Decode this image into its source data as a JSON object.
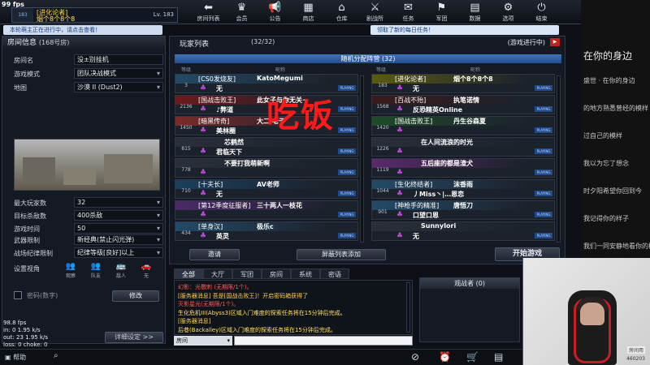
{
  "fps_top": "99 fps",
  "player": {
    "rank_text": "183",
    "clan_tag": "[进化论者]",
    "name": "烟个8个8个8",
    "level": "Lv. 183"
  },
  "nav": [
    {
      "label": "房间列表",
      "icon": "back-arrow-icon",
      "glyph": "⬅"
    },
    {
      "label": "会员",
      "icon": "crown-icon",
      "glyph": "♛"
    },
    {
      "label": "公告",
      "icon": "megaphone-icon",
      "glyph": "📢"
    },
    {
      "label": "商店",
      "icon": "shop-icon",
      "glyph": "▦"
    },
    {
      "label": "仓库",
      "icon": "warehouse-icon",
      "glyph": "⌂"
    },
    {
      "label": "剧战所",
      "icon": "battle-icon",
      "glyph": "⚔"
    },
    {
      "label": "任务",
      "icon": "mission-icon",
      "glyph": "✉"
    },
    {
      "label": "军团",
      "icon": "legion-icon",
      "glyph": "⚑"
    },
    {
      "label": "数据",
      "icon": "data-icon",
      "glyph": "▤"
    },
    {
      "label": "选项",
      "icon": "gear-icon",
      "glyph": "⚙"
    },
    {
      "label": "结束",
      "icon": "power-icon",
      "glyph": "⏻"
    }
  ],
  "notices": {
    "left": "本轮萌主正在进行中，请点击查看！",
    "right": "领取了新的每日任务！"
  },
  "room": {
    "title": "房间信息",
    "room_no": "(168号房)",
    "rows": [
      {
        "label": "房间名",
        "value": "没±别挂机",
        "dropdown": false
      },
      {
        "label": "游戏模式",
        "value": "团队决战模式",
        "dropdown": true
      },
      {
        "label": "地图",
        "value": "沙漠 II (Dust2)",
        "dropdown": true
      }
    ],
    "rows2": [
      {
        "label": "最大玩家数",
        "value": "32",
        "dropdown": true
      },
      {
        "label": "目标杀敌数",
        "value": "400杀敌",
        "dropdown": true
      },
      {
        "label": "游戏时间",
        "value": "50",
        "dropdown": true
      }
    ],
    "rows3": [
      {
        "label": "武器限制",
        "value": "新经典(禁止闪光弹)",
        "dropdown": true
      },
      {
        "label": "战场纪律限制",
        "value": "纪律等级[良好]以上",
        "dropdown": true
      }
    ],
    "view_label": "设置视角",
    "view_options": [
      "观察",
      "队友",
      "敌人",
      "无"
    ],
    "password_label": "密码(数字)",
    "modify_btn": "修改",
    "detail_btn": "详细设定 >>"
  },
  "list": {
    "title": "玩家列表",
    "count": "(32/32)",
    "status": "(游戏进行中)",
    "assign": "随机分配阵营 (32)",
    "col_rank": "等级",
    "col_name": "昵称",
    "team_a": [
      {
        "rank": "3",
        "clan": "[CS0发烧友]",
        "name": "KatoMegumi",
        "sub": "无",
        "color": "#244a66"
      },
      {
        "rank": "2136",
        "clan": "[国战击败王]",
        "name": "此女子与你无关~",
        "sub": "♪弊道",
        "color": "#6a1b1b"
      },
      {
        "rank": "1450",
        "clan": "[暗黑传奇]",
        "name": "大二·老于",
        "sub": "美林圈",
        "color": "#7a2b2b"
      },
      {
        "rank": "815",
        "clan": "",
        "name": "芯鹤然",
        "sub": "君临天下",
        "color": "#2a2f3a"
      },
      {
        "rank": "778",
        "clan": "",
        "name": "不要打我萌新啊",
        "sub": "",
        "color": "#2a2f3a"
      },
      {
        "rank": "710",
        "clan": "[十夫长]",
        "name": "AV老师",
        "sub": "无",
        "color": "#1b3f5c"
      },
      {
        "rank": "",
        "clan": "[第12季度征服者]",
        "name": "三十两人一枝花",
        "sub": "",
        "color": "#4b2a66"
      },
      {
        "rank": "434",
        "clan": "[单身汉]",
        "name": "极乐c",
        "sub": "英灵",
        "color": "#244a66"
      }
    ],
    "team_b": [
      {
        "rank": "183",
        "clan": "[进化论者]",
        "name": "烟个8个8个8",
        "sub": "无",
        "color": "#5a5a12"
      },
      {
        "rank": "1568",
        "clan": "[百战不殆]",
        "name": "执笔诺情",
        "sub": "反恐精英Online",
        "color": "#3a1b1b"
      },
      {
        "rank": "1420",
        "clan": "[国战击败王]",
        "name": "丹生谷森夏",
        "sub": "",
        "color": "#1f4a2a"
      },
      {
        "rank": "1226",
        "clan": "",
        "name": "在人间流浪的时光",
        "sub": "",
        "color": "#2a2f3a"
      },
      {
        "rank": "1119",
        "clan": "",
        "name": "五后座的都是渣犬",
        "sub": "",
        "color": "#5a2a6a"
      },
      {
        "rank": "1044",
        "clan": "[生化终结者]",
        "name": "沫香雨",
        "sub": "丿Miss丶|…恩恋",
        "color": "#244a66"
      },
      {
        "rank": "901",
        "clan": "[神枪手的精准]",
        "name": "唐悟刀",
        "sub": "口望口恩",
        "color": "#244a66"
      },
      {
        "rank": "",
        "clan": "",
        "name": "SunnyIori",
        "sub": "无",
        "color": "#2a2f3a"
      }
    ],
    "invite_btn": "邀请",
    "block_btn": "屏蔽列表添加",
    "start_btn": "开始游戏"
  },
  "chat": {
    "tabs": [
      "全部",
      "大厅",
      "军团",
      "房间",
      "系统",
      "密语"
    ],
    "lines": [
      {
        "text": "幻影：光檄刺 (无期限/1个)。",
        "color": "#ff5a5a"
      },
      {
        "text": "[服务器消息] 吾是[国战击败王]！开启密码箱获得了",
        "color": "#ffcc44"
      },
      {
        "text": "灭影星光(无期限/1个)。",
        "color": "#ff5a5a"
      },
      {
        "text": "生化危机III(Abyss3)区域入门难度的探索任务将在15分钟后完成。",
        "color": "#ffe066"
      },
      {
        "text": "[服务器消息]",
        "color": "#ffcc44"
      },
      {
        "text": "后巷(Backalley)区域入门难度的探索任务将在15分钟后完成。",
        "color": "#ffe066"
      }
    ],
    "input_channel": "房间"
  },
  "watch": {
    "title": "观战者 (0)"
  },
  "stats": {
    "fps": "98.8 fps",
    "in": "in: 0 1.95 k/s",
    "out": "out: 23 1.95 k/s",
    "loss": "loss: 0 choke: 0"
  },
  "help_label": "帮助",
  "overlay": "吃饭",
  "side_chat": [
    "在你的身边",
    "盛世 · 在你的身边",
    "的地方熟悉曾经的模样",
    "过自己的模样",
    "我以为忘了想念",
    "时夕阳希望你回到今",
    "我记得你的样子",
    "我们一同安静地看你的模样"
  ],
  "cam": {
    "label": "房间用",
    "id": "460203"
  }
}
